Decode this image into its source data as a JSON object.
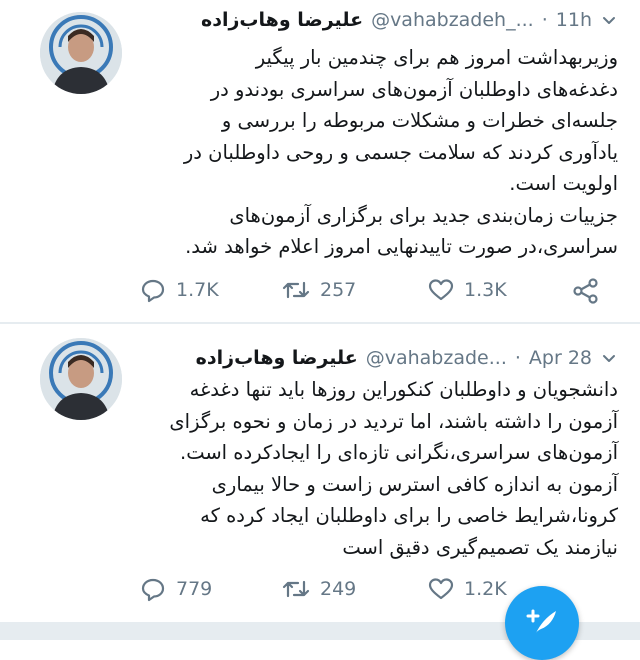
{
  "tweets": [
    {
      "author_name": "علیرضا وهاب‌زاده",
      "handle": "@vahabzadeh_...",
      "separator": "·",
      "time": "11h",
      "lines": [
        "وزیربهداشت امروز هم برای چندمین بار پیگیر",
        "دغدغه‌های داوطلبان آزمون‌های سراسری بودندو در",
        "جلسه‌ای خطرات و مشکلات مربوطه را بررسی و",
        "یادآوری کردند که سلامت جسمی و روحی داوطلبان در",
        "اولویت است.",
        "جزییات زمان‌بندی جدید برای برگزاری آزمون‌های",
        "سراسری،در صورت تاییدنهایی امروز اعلام خواهد شد."
      ],
      "replies": "1.7K",
      "retweets": "257",
      "likes": "1.3K"
    },
    {
      "author_name": "علیرضا وهاب‌زاده",
      "handle": "@vahabzade...",
      "separator": "·",
      "time": "Apr 28",
      "lines": [
        "دانشجویان و داوطلبان کنکوراین روزها باید تنها دغدغه",
        "آزمون را داشته باشند، اما تردید در زمان و نحوه برگزای",
        "آزمون‌های سراسری،نگرانی تازه‌ای را ایجادکرده است.",
        "آزمون به اندازه کافی استرس زاست و حالا بیماری",
        "کرونا،شرایط خاصی را برای داوطلبان ایجاد کرده که",
        "نیازمند یک تصمیم‌گیری دقیق است"
      ],
      "replies": "779",
      "retweets": "249",
      "likes": "1.2K"
    }
  ],
  "icons": {
    "reply": "reply-icon",
    "retweet": "retweet-icon",
    "like": "like-icon",
    "share": "share-icon",
    "menu": "chevron-down-icon",
    "compose": "compose-tweet-icon"
  },
  "colors": {
    "text": "#14171a",
    "secondary": "#657786",
    "accent": "#1da1f2",
    "divider": "#e6ecf0"
  }
}
